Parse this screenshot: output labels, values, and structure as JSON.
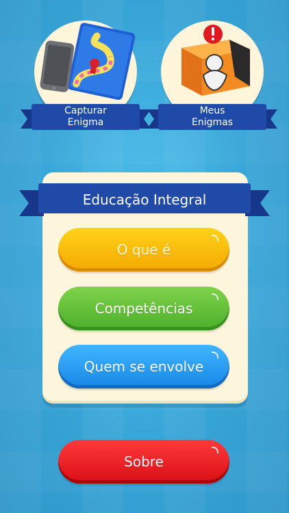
{
  "tiles": {
    "capture": {
      "label": "Capturar\nEnigma",
      "icon": "phone-board-game-icon"
    },
    "my_puzzles": {
      "label": "Meus\nEnigmas",
      "icon": "puzzle-cube-icon"
    }
  },
  "panel": {
    "title": "Educação Integral",
    "buttons": {
      "what_is": "O que é",
      "competencies": "Competências",
      "who_is_involved": "Quem se envolve"
    }
  },
  "about_button": "Sobre",
  "colors": {
    "background": "#3ba8d8",
    "ribbon": "#1f4aa8",
    "panel": "#fdf5dc",
    "yellow": "#f5a800",
    "green": "#4cae2a",
    "blue": "#1886e6",
    "red": "#d80f16"
  }
}
